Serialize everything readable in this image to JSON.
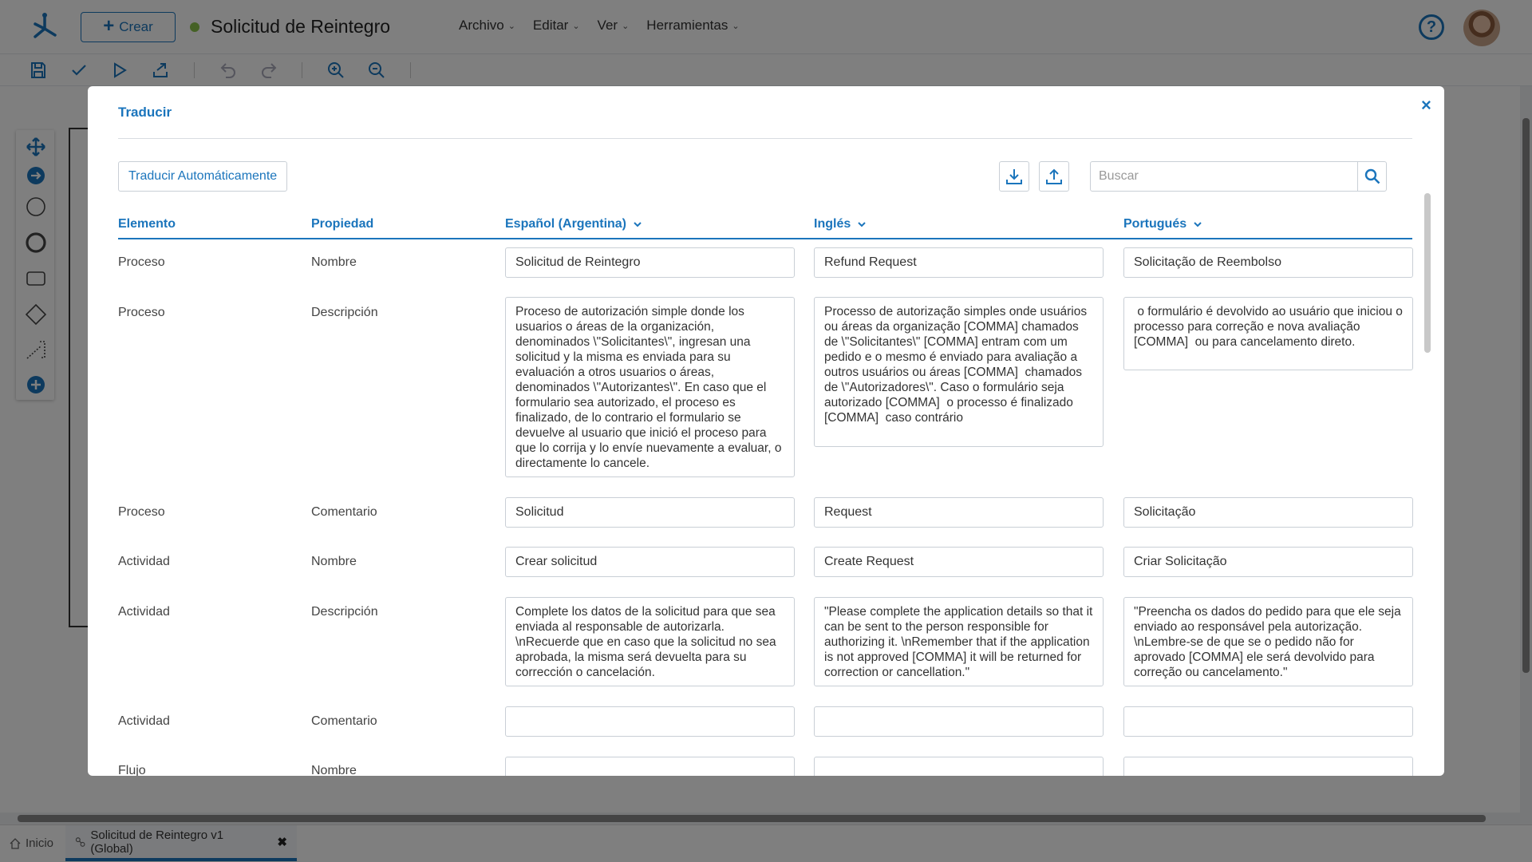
{
  "app": {
    "create_label": "Crear",
    "title": "Solicitud de Reintegro",
    "menu": [
      "Archivo",
      "Editar",
      "Ver",
      "Herramientas"
    ],
    "help_symbol": "?"
  },
  "bottom_tabs": {
    "home_label": "Inicio",
    "process_label": "Solicitud de Reintegro v1 (Global)",
    "close_symbol": "✖"
  },
  "modal": {
    "title": "Traducir",
    "close_symbol": "×",
    "auto_translate_label": "Traducir Automáticamente",
    "search_placeholder": "Buscar",
    "columns": {
      "element": "Elemento",
      "property": "Propiedad",
      "lang1": "Español (Argentina)",
      "lang2": "Inglés",
      "lang3": "Portugués"
    },
    "rows": [
      {
        "element": "Proceso",
        "property": "Nombre",
        "es": "Solicitud de Reintegro",
        "en": "Refund Request",
        "pt": "Solicitação de Reembolso"
      },
      {
        "element": "Proceso",
        "property": "Descripción",
        "es": "Proceso de autorización simple donde los usuarios o áreas de la organización, denominados \\\"Solicitantes\\\", ingresan una solicitud y la misma es enviada para su evaluación a otros usuarios o áreas, denominados \\\"Autorizantes\\\". En caso que el formulario sea autorizado, el proceso es finalizado, de lo contrario el formulario se devuelve al usuario que inició el proceso para que lo corrija y lo envíe nuevamente a evaluar, o directamente lo cancele.",
        "en": "Processo de autorização simples onde usuários ou áreas da organização [COMMA] chamados de \\\"Solicitantes\\\" [COMMA] entram com um pedido e o mesmo é enviado para avaliação a outros usuários ou áreas [COMMA]  chamados de \\\"Autorizadores\\\". Caso o formulário seja autorizado [COMMA]  o processo é finalizado [COMMA]  caso contrário",
        "pt": " o formulário é devolvido ao usuário que iniciou o processo para correção e nova avaliação [COMMA]  ou para cancelamento direto."
      },
      {
        "element": "Proceso",
        "property": "Comentario",
        "es": "Solicitud",
        "en": "Request",
        "pt": "Solicitação"
      },
      {
        "element": "Actividad",
        "property": "Nombre",
        "es": "Crear solicitud",
        "en": "Create Request",
        "pt": "Criar Solicitação"
      },
      {
        "element": "Actividad",
        "property": "Descripción",
        "es": "Complete los datos de la solicitud para que sea enviada al responsable de autorizarla. \\nRecuerde que en caso que la solicitud no sea aprobada, la misma será devuelta para su corrección o cancelación.",
        "en": "\"Please complete the application details so that it can be sent to the person responsible for authorizing it. \\nRemember that if the application is not approved [COMMA] it will be returned for correction or cancellation.\"",
        "pt": "\"Preencha os dados do pedido para que ele seja enviado ao responsável pela autorização. \\nLembre-se de que se o pedido não for aprovado [COMMA] ele será devolvido para correção ou cancelamento.\""
      },
      {
        "element": "Actividad",
        "property": "Comentario",
        "es": "",
        "en": "",
        "pt": ""
      },
      {
        "element": "Flujo",
        "property": "Nombre",
        "es": "",
        "en": "",
        "pt": ""
      }
    ]
  },
  "colors": {
    "accent": "#1b75bc",
    "status_dot": "#8bc34a",
    "overlay": "rgba(0,0,0,0.5)"
  },
  "icons": [
    "logo-icon",
    "plus-icon",
    "help-icon",
    "save-icon",
    "check-icon",
    "play-icon",
    "export-icon",
    "undo-icon",
    "redo-icon",
    "zoom-in-icon",
    "zoom-out-icon",
    "download-icon",
    "upload-icon",
    "search-icon",
    "chevron-down-icon",
    "home-icon",
    "process-icon",
    "close-icon"
  ]
}
